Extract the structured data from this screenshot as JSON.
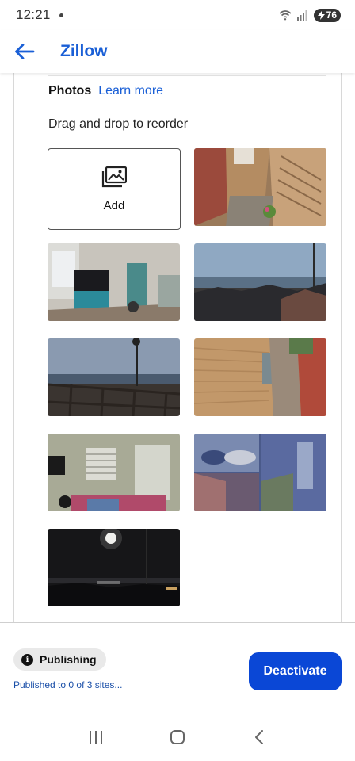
{
  "status_bar": {
    "time": "12:21",
    "battery": "76"
  },
  "header": {
    "title": "Zillow"
  },
  "photos": {
    "title": "Photos",
    "learn_more": "Learn more",
    "hint": "Drag and drop to reorder",
    "add_label": "Add"
  },
  "footer": {
    "badge_label": "Publishing",
    "status_text": "Published to 0 of 3 sites...",
    "deactivate_label": "Deactivate"
  },
  "colors": {
    "accent": "#1a5fd6",
    "primary_button": "#0a47d6"
  }
}
